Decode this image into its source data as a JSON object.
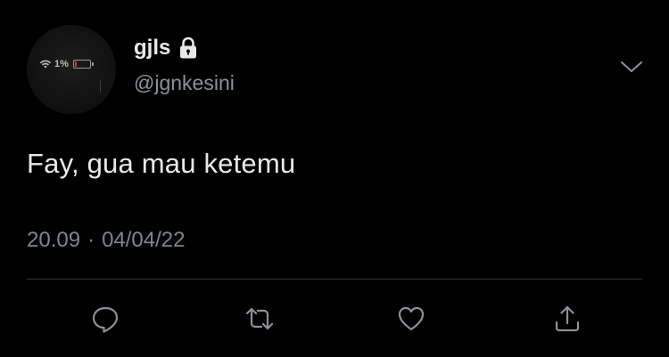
{
  "tweet": {
    "display_name": "gjls",
    "handle": "@jgnkesini",
    "text": "Fay, gua mau ketemu",
    "time": "20.09",
    "separator": "·",
    "date": "04/04/22",
    "avatar_status": {
      "battery_text": "1%"
    }
  },
  "icons": {
    "lock": "lock-icon",
    "more": "chevron-down-icon",
    "reply": "reply-icon",
    "retweet": "retweet-icon",
    "like": "heart-icon",
    "share": "share-icon"
  },
  "colors": {
    "background": "#000000",
    "primary_text": "#e7e9ea",
    "secondary_text": "#8b9298",
    "divider": "#2f3336",
    "icon": "#8b9298"
  }
}
